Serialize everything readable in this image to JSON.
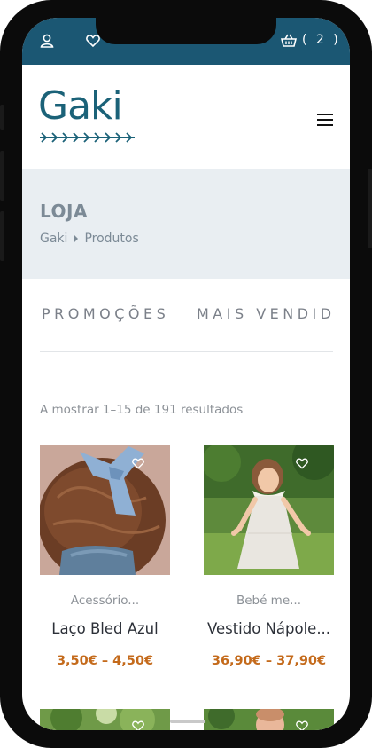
{
  "topbar": {
    "cart_count": "( 2 )",
    "bg": "#1b5773"
  },
  "header": {
    "logo": "Gaki"
  },
  "page": {
    "title": "LOJA",
    "breadcrumb": [
      "Gaki",
      "Produtos"
    ]
  },
  "tabs": [
    {
      "label": "PROMOÇÕES"
    },
    {
      "label": "MAIS VENDID"
    }
  ],
  "results_text": "A mostrar 1–15 de 191 resultados",
  "products": [
    {
      "category": "Acessório...",
      "name": "Laço Bled Azul",
      "price": "3,50€ – 4,50€"
    },
    {
      "category": "Bebé me...",
      "name": "Vestido Nápole...",
      "price": "36,90€ – 37,90€"
    }
  ],
  "colors": {
    "brand": "#1b6278",
    "price": "#c46a1b",
    "banner": "#e9eef2"
  }
}
